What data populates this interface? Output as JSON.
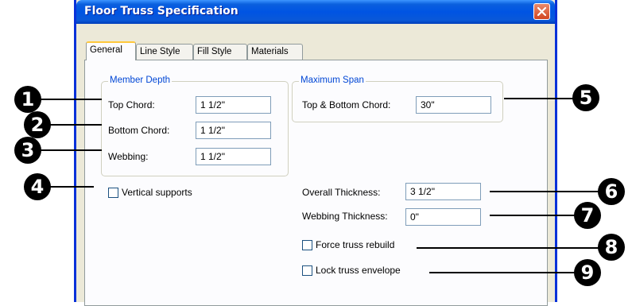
{
  "dialog": {
    "title": "Floor Truss Specification",
    "tabs": [
      "General",
      "Line Style",
      "Fill Style",
      "Materials"
    ],
    "member_depth": {
      "title": "Member Depth",
      "top_chord_label": "Top Chord:",
      "top_chord_value": "1 1/2\"",
      "bottom_chord_label": "Bottom Chord:",
      "bottom_chord_value": "1 1/2\"",
      "webbing_label": "Webbing:",
      "webbing_value": "1 1/2\""
    },
    "maximum_span": {
      "title": "Maximum Span",
      "label": "Top & Bottom Chord:",
      "value": "30\""
    },
    "vertical_supports_label": "Vertical supports",
    "overall_thickness_label": "Overall Thickness:",
    "overall_thickness_value": "3 1/2\"",
    "webbing_thickness_label": "Webbing Thickness:",
    "webbing_thickness_value": "0\"",
    "force_rebuild_label": "Force truss rebuild",
    "lock_envelope_label": "Lock truss envelope"
  },
  "callouts": [
    "1",
    "2",
    "3",
    "4",
    "5",
    "6",
    "7",
    "8",
    "9"
  ]
}
